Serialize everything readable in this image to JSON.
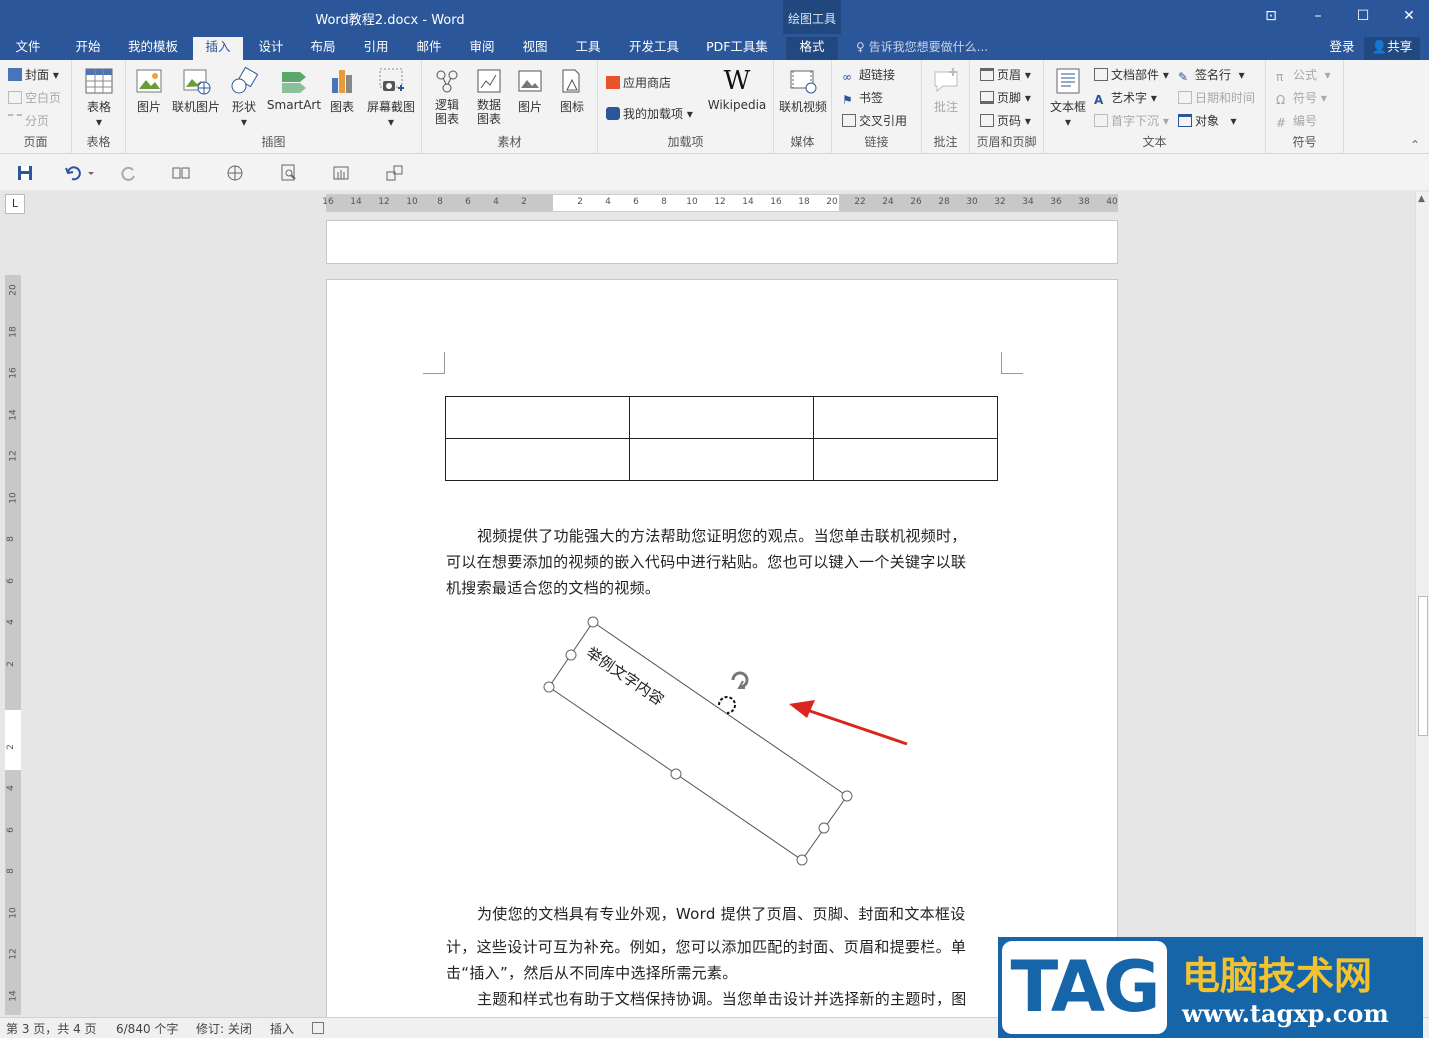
{
  "window": {
    "title": "Word教程2.docx - Word",
    "context_group": "绘图工具",
    "login": "登录",
    "share": "共享"
  },
  "tabs": [
    "文件",
    "开始",
    "我的模板",
    "插入",
    "设计",
    "布局",
    "引用",
    "邮件",
    "审阅",
    "视图",
    "工具",
    "开发工具",
    "PDF工具集",
    "格式"
  ],
  "active_tab": "插入",
  "tell_me": "告诉我您想要做什么...",
  "ribbon": {
    "pages": {
      "cover": "封面",
      "blank": "空白页",
      "break": "分页",
      "label": "页面"
    },
    "tables": {
      "table": "表格",
      "label": "表格"
    },
    "illustrations": {
      "picture": "图片",
      "online_picture": "联机图片",
      "shapes": "形状",
      "smartart": "SmartArt",
      "chart": "图表",
      "screenshot": "屏幕截图",
      "label": "插图"
    },
    "material": {
      "logic": "逻辑\n图表",
      "data": "数据\n图表",
      "picture": "图片",
      "icon": "图标",
      "label": "素材"
    },
    "addins": {
      "store": "应用商店",
      "my_addins": "我的加载项",
      "wikipedia": "Wikipedia",
      "label": "加载项"
    },
    "media": {
      "online_video": "联机视频",
      "label": "媒体"
    },
    "links": {
      "hyperlink": "超链接",
      "bookmark": "书签",
      "crossref": "交叉引用",
      "label": "链接"
    },
    "comments": {
      "comment": "批注",
      "label": "批注"
    },
    "header_footer": {
      "header": "页眉",
      "footer": "页脚",
      "page_number": "页码",
      "label": "页眉和页脚"
    },
    "text": {
      "textbox": "文本框",
      "quick_parts": "文档部件",
      "wordart": "艺术字",
      "dropcap": "首字下沉",
      "signature": "签名行",
      "datetime": "日期和时间",
      "object": "对象",
      "label": "文本"
    },
    "symbols": {
      "equation": "公式",
      "symbol": "符号",
      "number": "编号",
      "label": "符号"
    }
  },
  "hruler_numbers": [
    "16",
    "14",
    "12",
    "10",
    "8",
    "6",
    "4",
    "2",
    "",
    "2",
    "4",
    "6",
    "8",
    "10",
    "12",
    "14",
    "16",
    "18",
    "20",
    "22",
    "24",
    "26",
    "28",
    "30",
    "32",
    "34",
    "36",
    "38",
    "40"
  ],
  "vruler_numbers": [
    "20",
    "18",
    "16",
    "14",
    "12",
    "10",
    "8",
    "6",
    "4",
    "2",
    "",
    "2",
    "4",
    "6",
    "8",
    "10",
    "12",
    "14"
  ],
  "document": {
    "para1": [
      "视频提供了功能强大的方法帮助您证明您的观点。当您单击联机视频时，",
      "可以在想要添加的视频的嵌入代码中进行粘贴。您也可以键入一个关键字以联",
      "机搜索最适合您的文档的视频。"
    ],
    "textbox_text": "举例文字内容",
    "para2": [
      "为使您的文档具有专业外观，Word 提供了页眉、页脚、封面和文本框设",
      "计，这些设计可互为补充。例如，您可以添加匹配的封面、页眉和提要栏。单",
      "击“插入”，然后从不同库中选择所需元素。",
      "主题和样式也有助于文档保持协调。当您单击设计并选择新的主题时，图"
    ]
  },
  "status": {
    "page": "第 3 页，共 4 页",
    "words": "6/840 个字",
    "track": "修订: 关闭",
    "mode": "插入"
  },
  "watermark": {
    "tag": "TAG",
    "title": "电脑技术网",
    "url": "www.tagxp.com"
  }
}
